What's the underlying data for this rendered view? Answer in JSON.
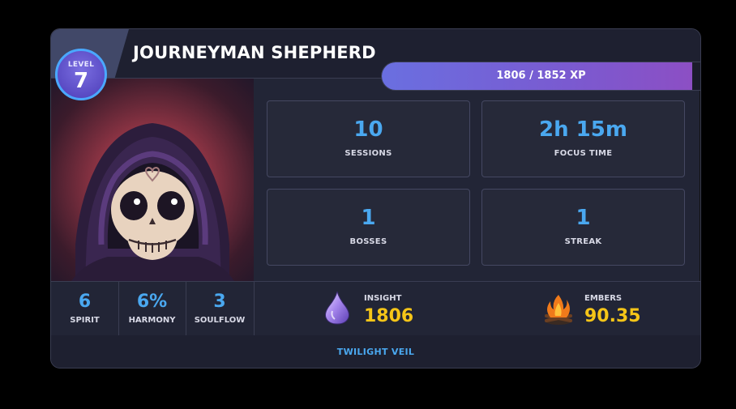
{
  "header": {
    "title": "JOURNEYMAN SHEPHERD",
    "level_label": "LEVEL",
    "level": "7"
  },
  "xp": {
    "text": "1806 / 1852 XP",
    "current": 1806,
    "max": 1852,
    "fill_fraction": 0.975
  },
  "stats": [
    {
      "value": "10",
      "label": "SESSIONS"
    },
    {
      "value": "2h 15m",
      "label": "FOCUS TIME"
    },
    {
      "value": "1",
      "label": "BOSSES"
    },
    {
      "value": "1",
      "label": "STREAK"
    }
  ],
  "attributes": [
    {
      "value": "6",
      "label": "SPIRIT"
    },
    {
      "value": "6%",
      "label": "HARMONY"
    },
    {
      "value": "3",
      "label": "SOULFLOW"
    }
  ],
  "currencies": {
    "insight": {
      "label": "INSIGHT",
      "value": "1806",
      "icon": "crystal-drop-icon"
    },
    "embers": {
      "label": "EMBERS",
      "value": "90.35",
      "icon": "campfire-icon"
    }
  },
  "footer": {
    "title": "TWILIGHT VEIL"
  },
  "colors": {
    "accent_blue": "#4aa8f0",
    "gold": "#f5c518",
    "card_bg": "#222536",
    "xp_gradient_start": "#6a6fe0",
    "xp_gradient_end": "#8c4fc4"
  },
  "portrait": {
    "icon": "hooded-skull-icon"
  }
}
